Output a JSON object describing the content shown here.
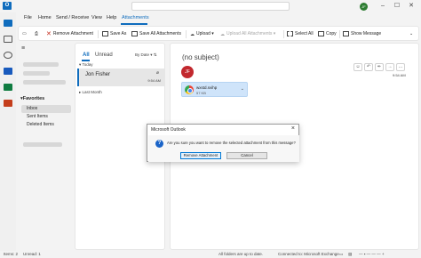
{
  "titlebar": {
    "app_letter": "O",
    "avatar": "JF",
    "min": "–",
    "max": "☐",
    "close": "✕"
  },
  "menu": [
    {
      "label": "File"
    },
    {
      "label": "Home"
    },
    {
      "label": "Send / Receive"
    },
    {
      "label": "View"
    },
    {
      "label": "Help"
    },
    {
      "label": "Attachments"
    }
  ],
  "ribbon": {
    "remove": "Remove Attachment",
    "save_as": "Save As",
    "save_all": "Save All Attachments",
    "upload": "Upload",
    "upload_all": "Upload All Attachments",
    "select_all": "Select All",
    "copy": "Copy",
    "show_message": "Show Message"
  },
  "folders": {
    "favorites": "Favorites",
    "items": [
      {
        "label": "Inbox"
      },
      {
        "label": "Sent Items"
      },
      {
        "label": "Deleted Items"
      }
    ]
  },
  "message_list": {
    "tab_all": "All",
    "tab_unread": "Unread",
    "sort": "By Date",
    "group_today": "Today",
    "group_last_month": "Last Month",
    "item": {
      "sender": "Jon Fisher",
      "time": "9:54 AM"
    }
  },
  "reading": {
    "subject": "(no subject)",
    "avatar": "JF",
    "time": "9:54 AM",
    "attachment": {
      "name": "wxstd.svihp",
      "size": "57 KB"
    }
  },
  "dialog": {
    "title": "Microsoft Outlook",
    "message": "Are you sure you want to remove the selected attachment from this message?",
    "confirm": "Remove Attachment",
    "cancel": "Cancel"
  },
  "status": {
    "items": "Items: 2",
    "unread": "Unread: 1",
    "sync": "All folders are up to date.",
    "connection": "Connected to: Microsoft Exchange"
  },
  "colors": {
    "accent": "#0f6cbd",
    "avatar": "#c2282e"
  }
}
